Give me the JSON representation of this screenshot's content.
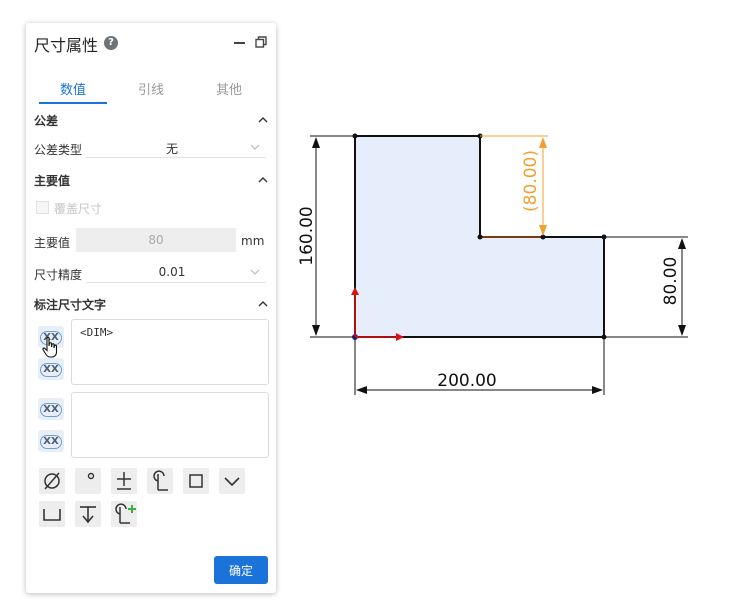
{
  "panel": {
    "title": "尺寸属性",
    "help_glyph": "?",
    "tabs": [
      {
        "label": "数值",
        "active": true
      },
      {
        "label": "引线",
        "active": false
      },
      {
        "label": "其他",
        "active": false
      }
    ],
    "tolerance": {
      "title": "公差",
      "type_label": "公差类型",
      "type_value": "无"
    },
    "primary": {
      "title": "主要值",
      "override_label": "覆盖尺寸",
      "value_label": "主要值",
      "value": "80",
      "unit": "mm",
      "precision_label": "尺寸精度",
      "precision_value": "0.01"
    },
    "dim_text": {
      "title": "标注尺寸文字",
      "xx_label": "XX",
      "main_text": "<DIM>",
      "secondary_text": ""
    },
    "ok_label": "确定",
    "accent_color": "#1a73d9"
  },
  "drawing": {
    "dim_bottom": "200.00",
    "dim_left": "160.00",
    "dim_right": "80.00",
    "dim_reference": "(80.00)",
    "shape_fill": "#e6edfb",
    "reference_color": "#f0a030"
  }
}
